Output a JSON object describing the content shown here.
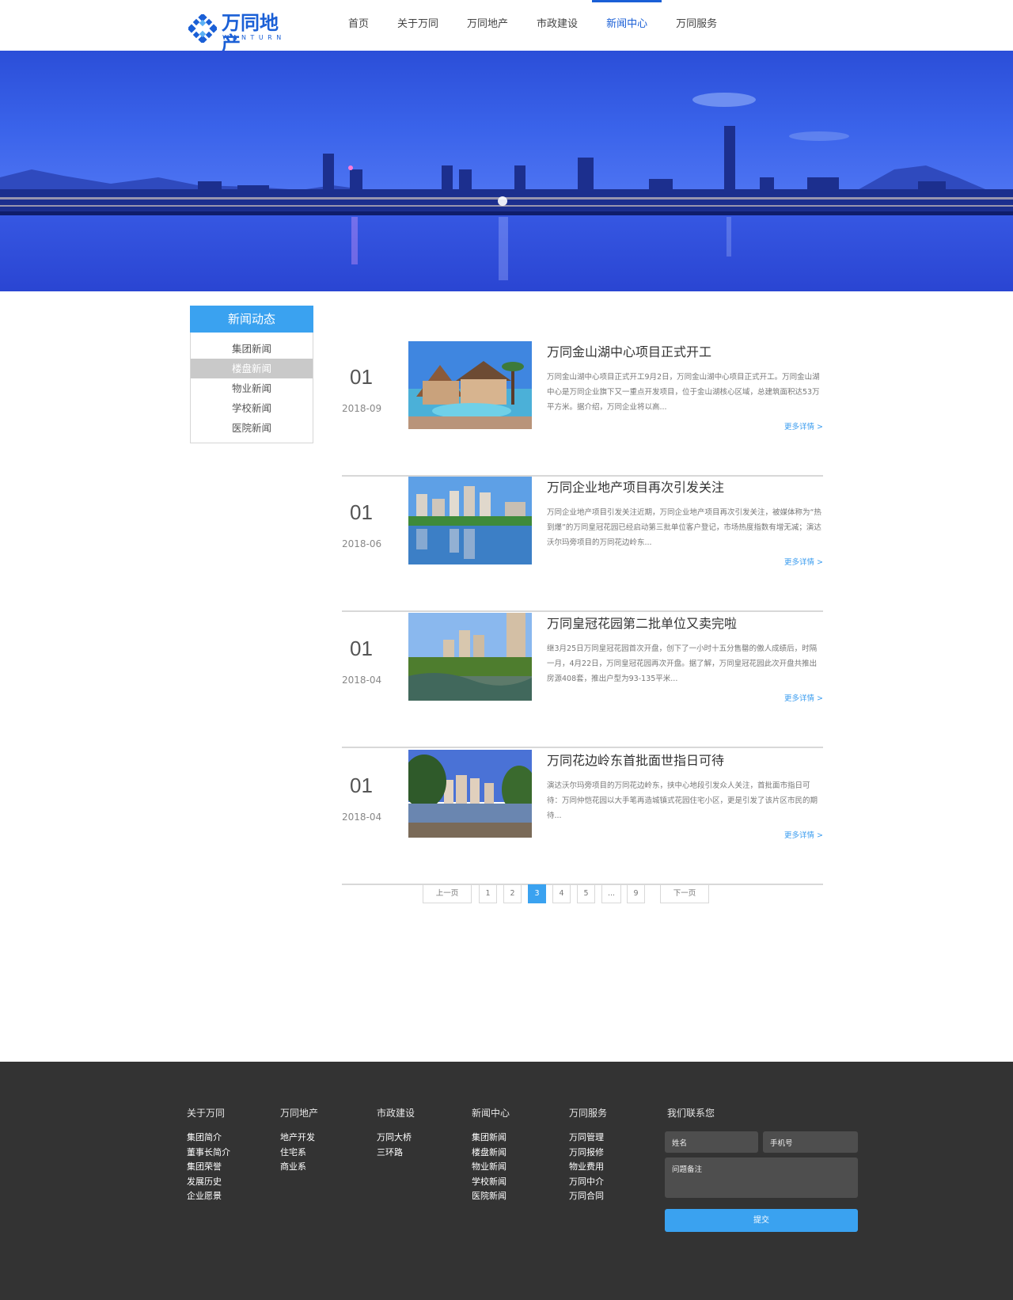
{
  "header": {
    "logo_cn": "万同地产",
    "logo_en": "WANTURN",
    "nav": [
      "首页",
      "关于万同",
      "万同地产",
      "市政建设",
      "新闻中心",
      "万同服务"
    ],
    "active_nav": "新闻中心"
  },
  "sidebar": {
    "title": "新闻动态",
    "items": [
      "集团新闻",
      "楼盘新闻",
      "物业新闻",
      "学校新闻",
      "医院新闻"
    ],
    "active": "楼盘新闻"
  },
  "news": [
    {
      "day": "01",
      "month": "2018-09",
      "title": "万同金山湖中心项目正式开工",
      "desc": "万同金山湖中心项目正式开工9月2日，万同金山湖中心项目正式开工。万同金山湖中心是万同企业旗下又一重点开发项目，位于金山湖核心区域，总建筑面积达53万平方米。据介绍，万同企业将以高...",
      "more": "更多详情 >"
    },
    {
      "day": "01",
      "month": "2018-06",
      "title": "万同企业地产项目再次引发关注",
      "desc": "万同企业地产项目引发关注近期，万同企业地产项目再次引发关注，被媒体称为“热到爆”的万同皇冠花园已经启动第三批单位客户登记，市场热度指数有增无减；演达沃尔玛旁项目的万同花边岭东...",
      "more": "更多详情 >"
    },
    {
      "day": "01",
      "month": "2018-04",
      "title": "万同皇冠花园第二批单位又卖完啦",
      "desc": "继3月25日万同皇冠花园首次开盘，创下了一小时十五分售罄的傲人成绩后，时隔一月，4月22日，万同皇冠花园再次开盘。据了解，万同皇冠花园此次开盘共推出房源408套，推出户型为93-135平米...",
      "more": "更多详情 >"
    },
    {
      "day": "01",
      "month": "2018-04",
      "title": "万同花边岭东首批面世指日可待",
      "desc": "演达沃尔玛旁项目的万同花边岭东，挟中心地段引发众人关注，首批面市指日可待：万同仲恺花园以大手笔再造城镇式花园住宅小区，更是引发了该片区市民的期待...",
      "more": "更多详情 >"
    }
  ],
  "pager": {
    "prev": "上一页",
    "pages": [
      "1",
      "2",
      "3",
      "4",
      "5",
      "...",
      "9"
    ],
    "current": "3",
    "next": "下一页"
  },
  "footer": {
    "columns": [
      {
        "title": "关于万同",
        "links": [
          "集团简介",
          "董事长简介",
          "集团荣誉",
          "发展历史",
          "企业愿景"
        ]
      },
      {
        "title": "万同地产",
        "links": [
          "地产开发",
          "住宅系",
          "商业系"
        ]
      },
      {
        "title": "市政建设",
        "links": [
          "万同大桥",
          "三环路"
        ]
      },
      {
        "title": "新闻中心",
        "links": [
          "集团新闻",
          "楼盘新闻",
          "物业新闻",
          "学校新闻",
          "医院新闻"
        ]
      },
      {
        "title": "万同服务",
        "links": [
          "万同管理",
          "万同报修",
          "物业费用",
          "万同中介",
          "万同合同"
        ]
      }
    ],
    "contact": {
      "title": "我们联系您",
      "name_placeholder": "姓名",
      "phone_placeholder": "手机号",
      "note_placeholder": "问题备注",
      "submit": "提交"
    }
  },
  "colors": {
    "brand": "#1a5fd6",
    "accent": "#3aa2f0",
    "footer_bg": "#333333"
  }
}
